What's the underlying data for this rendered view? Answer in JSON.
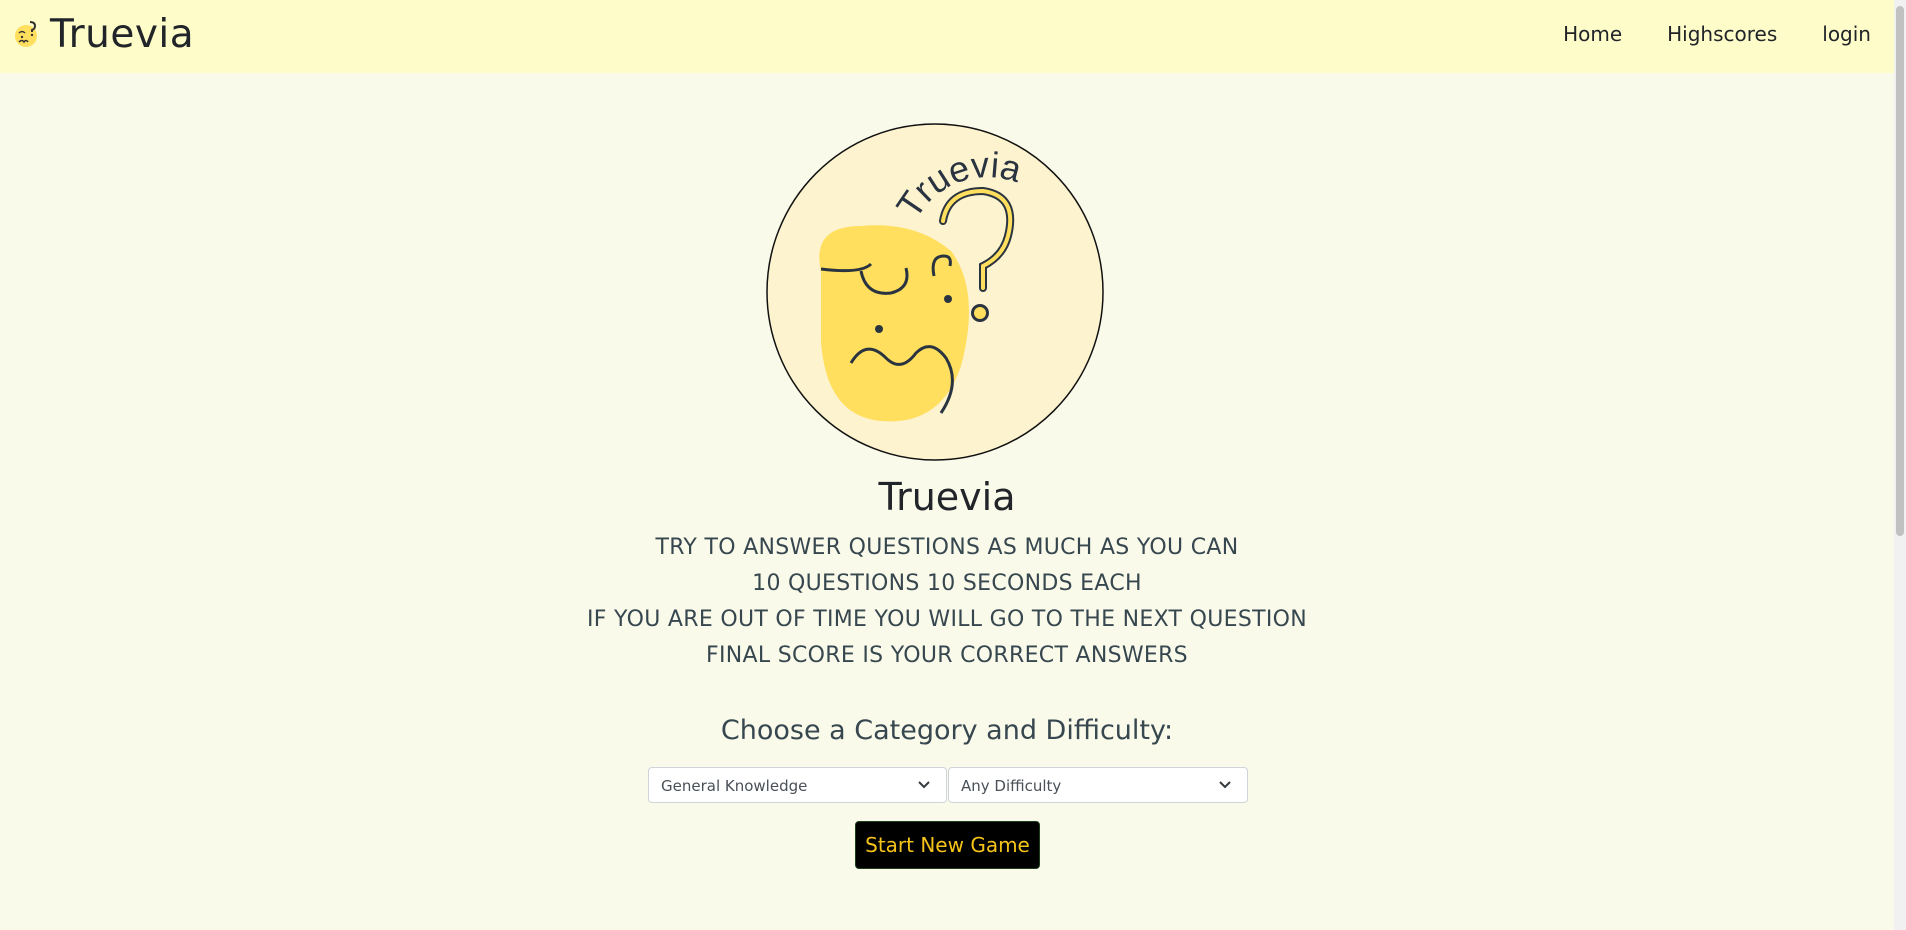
{
  "navbar": {
    "brand": "Truevia",
    "links": [
      "Home",
      "Highscores",
      "login"
    ]
  },
  "hero": {
    "logo_text": "Truevia"
  },
  "main": {
    "title": "Truevia",
    "rules": [
      "TRY TO ANSWER QUESTIONS AS MUCH AS YOU CAN",
      "10 QUESTIONS 10 SECONDS EACH",
      "IF YOU ARE OUT OF TIME YOU WILL GO TO THE NEXT QUESTION",
      "FINAL SCORE IS YOUR CORRECT ANSWERS"
    ],
    "choose_label": "Choose a Category and Difficulty:",
    "category_select": "General Knowledge",
    "difficulty_select": "Any Difficulty",
    "start_button": "Start New Game"
  },
  "colors": {
    "navbar_bg": "#fefcc8",
    "page_bg": "#fafaea",
    "accent_yellow": "#ffdf5d",
    "button_text": "#f6c419"
  }
}
